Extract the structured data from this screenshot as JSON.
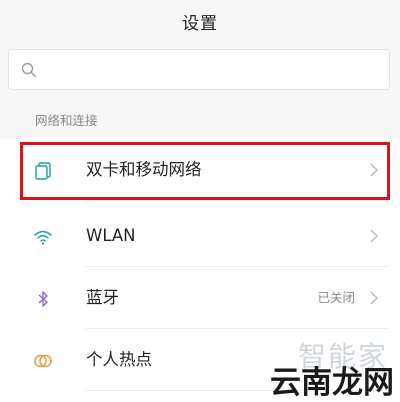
{
  "header": {
    "title": "设置"
  },
  "search": {
    "placeholder": "",
    "icon": "search-icon"
  },
  "section": {
    "label": "网络和连接"
  },
  "items": [
    {
      "label": "双卡和移动网络",
      "status": "",
      "icon": "sim-cards-icon",
      "icon_color": "#1aa39a"
    },
    {
      "label": "WLAN",
      "status": "",
      "icon": "wifi-icon",
      "icon_color": "#1aa39a"
    },
    {
      "label": "蓝牙",
      "status": "已关闭",
      "icon": "bluetooth-icon",
      "icon_color": "#8c6bc8"
    },
    {
      "label": "个人热点",
      "status": "",
      "icon": "hotspot-icon",
      "icon_color": "#e0a040"
    }
  ],
  "highlight": {
    "color": "#d6141b",
    "target": "双卡和移动网络"
  },
  "watermark": {
    "bg_text": "智能家",
    "fg_text": "云南龙网"
  }
}
